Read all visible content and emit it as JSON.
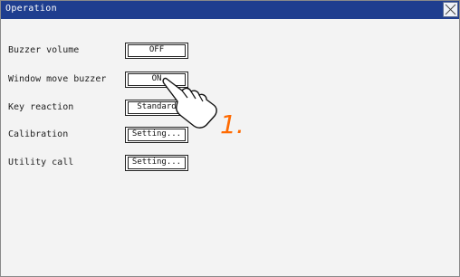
{
  "window": {
    "title": "Operation"
  },
  "rows": [
    {
      "label": "Buzzer volume",
      "value": "OFF"
    },
    {
      "label": "Window move buzzer",
      "value": "ON"
    },
    {
      "label": "Key reaction",
      "value": "Standard"
    },
    {
      "label": "Calibration",
      "value": "Setting..."
    },
    {
      "label": "Utility call",
      "value": "Setting..."
    }
  ],
  "annotation": {
    "step": "1.",
    "hand": "pointing-hand-icon"
  },
  "colors": {
    "titlebar": "#1f3e8f",
    "accent": "#ff6a00"
  }
}
